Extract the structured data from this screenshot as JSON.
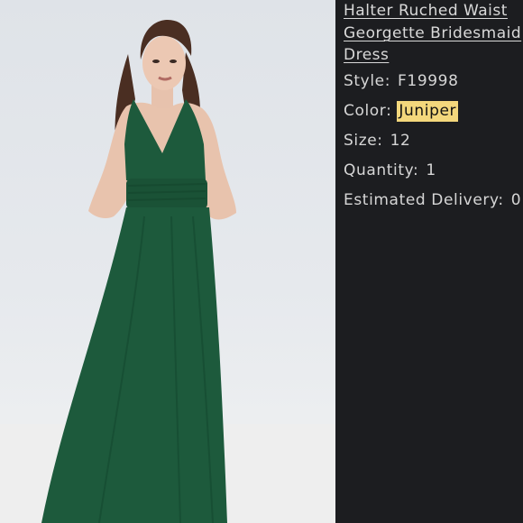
{
  "product": {
    "title_lines": [
      "Halter Ruched Waist",
      "Georgette Bridesmaid",
      "Dress"
    ],
    "details": [
      {
        "label": "Style:",
        "value": "F19998",
        "highlight": false
      },
      {
        "label": "Color:",
        "value": "Juniper",
        "highlight": true
      },
      {
        "label": "Size:",
        "value": "12",
        "highlight": false
      },
      {
        "label": "Quantity:",
        "value": "1",
        "highlight": false
      },
      {
        "label": "Estimated Delivery:",
        "value": "0",
        "highlight": false
      }
    ]
  },
  "colors": {
    "panel_bg": "#1c1d20",
    "text": "#d6d6d6",
    "highlight_bg": "#f3d77c",
    "dress": "#1d5a3c",
    "photo_bg": "#e3e6ea"
  },
  "image": {
    "icon": "dress-model-photo"
  }
}
